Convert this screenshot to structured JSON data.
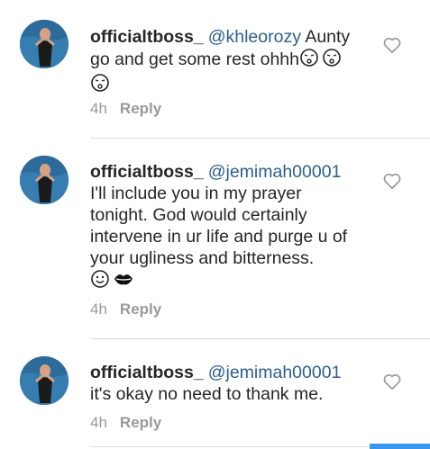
{
  "comments": [
    {
      "username": "officialtboss_",
      "mention": "@khleorozy",
      "text": "Aunty go and get some rest ohhh",
      "emojis": [
        "kiss-face-icon",
        "kiss-face-icon",
        "kiss-face-icon"
      ],
      "time": "4h",
      "reply_label": "Reply"
    },
    {
      "username": "officialtboss_",
      "mention": "@jemimah00001",
      "text": "I'll include you in my prayer tonight. God would certainly intervene in ur life and purge u of your ugliness and bitterness.",
      "emojis": [
        "smile-face-icon",
        "lips-icon"
      ],
      "time": "4h",
      "reply_label": "Reply"
    },
    {
      "username": "officialtboss_",
      "mention": "@jemimah00001",
      "text": "it's okay no need to thank me.",
      "emojis": [],
      "time": "4h",
      "reply_label": "Reply"
    }
  ],
  "colors": {
    "mention": "#2b5f8c",
    "meta": "#999999",
    "divider": "#dbdbdb",
    "accent": "#3897f0"
  }
}
